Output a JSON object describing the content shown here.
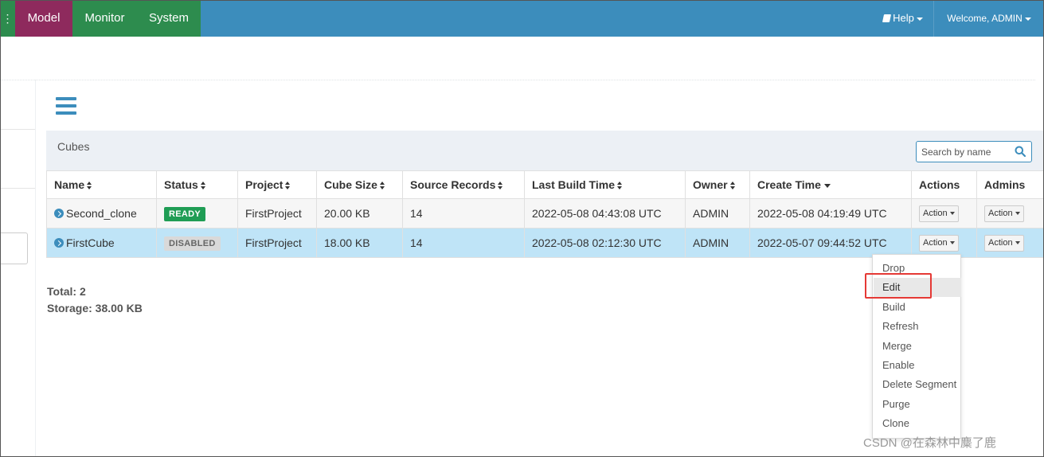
{
  "nav": {
    "edge_glyph": "⋮",
    "tabs": [
      {
        "label": "Model",
        "active": true
      },
      {
        "label": "Monitor",
        "active": false
      },
      {
        "label": "System",
        "active": false
      }
    ],
    "help_label": "Help",
    "welcome_label": "Welcome, ADMIN"
  },
  "panel": {
    "title": "Cubes",
    "search_placeholder": "Search by name"
  },
  "table": {
    "columns": [
      {
        "label": "Name"
      },
      {
        "label": "Status"
      },
      {
        "label": "Project"
      },
      {
        "label": "Cube Size"
      },
      {
        "label": "Source Records"
      },
      {
        "label": "Last Build Time"
      },
      {
        "label": "Owner"
      },
      {
        "label": "Create Time"
      },
      {
        "label": "Actions"
      },
      {
        "label": "Admins"
      }
    ],
    "rows": [
      {
        "name": "Second_clone",
        "status": "READY",
        "project": "FirstProject",
        "cube_size": "20.00 KB",
        "source_records": "14",
        "last_build_time": "2022-05-08 04:43:08 UTC",
        "owner": "ADMIN",
        "create_time": "2022-05-08 04:19:49 UTC",
        "action_label": "Action",
        "admin_action_label": "Action"
      },
      {
        "name": "FirstCube",
        "status": "DISABLED",
        "project": "FirstProject",
        "cube_size": "18.00 KB",
        "source_records": "14",
        "last_build_time": "2022-05-08 02:12:30 UTC",
        "owner": "ADMIN",
        "create_time": "2022-05-07 09:44:52 UTC",
        "action_label": "Action",
        "admin_action_label": "Action"
      }
    ]
  },
  "totals": {
    "total": "Total: 2",
    "storage": "Storage: 38.00 KB"
  },
  "action_menu": {
    "items": [
      "Drop",
      "Edit",
      "Build",
      "Refresh",
      "Merge",
      "Enable",
      "Delete Segment",
      "Purge",
      "Clone"
    ],
    "highlighted": "Edit"
  },
  "watermark": "CSDN @在森林中麋了鹿",
  "colors": {
    "navbar": "#3c8dbc",
    "model_tab": "#8e2a5d",
    "green_tab": "#2d8c4e",
    "selected_row": "#bfe4f7",
    "ready_badge": "#1f9d55",
    "highlight_border": "#e53935"
  }
}
